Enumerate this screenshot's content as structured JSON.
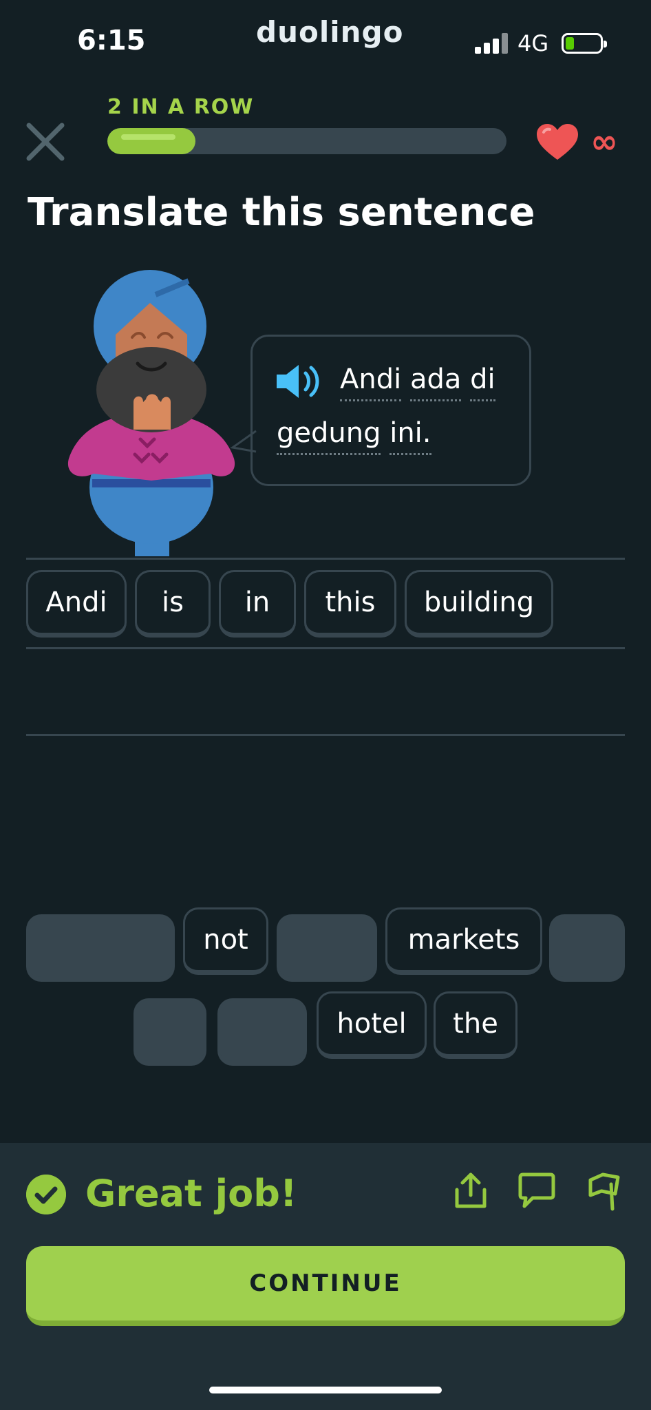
{
  "status_bar": {
    "time": "6:15",
    "brand": "duolingo",
    "network": "4G"
  },
  "header": {
    "streak_label": "2 IN A ROW",
    "progress": 0.22,
    "lives": "∞"
  },
  "title": "Translate this sentence",
  "prompt": {
    "words_line1": [
      "Andi",
      "ada",
      "di"
    ],
    "words_line2": [
      "gedung",
      "ini."
    ]
  },
  "answer_tiles": [
    "Andi",
    "is",
    "in",
    "this",
    "building"
  ],
  "word_bank": {
    "row1": [
      "",
      "not",
      "",
      "markets",
      ""
    ],
    "row2": [
      "",
      "",
      "hotel",
      "the"
    ]
  },
  "feedback": {
    "message": "Great job!",
    "button": "CONTINUE"
  },
  "colors": {
    "accent_green": "#95c93f",
    "background": "#131f24",
    "heart": "#ee5555",
    "footer": "#202f36"
  },
  "icons": [
    "close-icon",
    "heart-icon",
    "speaker-icon",
    "check-icon",
    "share-icon",
    "comment-icon",
    "flag-icon"
  ]
}
